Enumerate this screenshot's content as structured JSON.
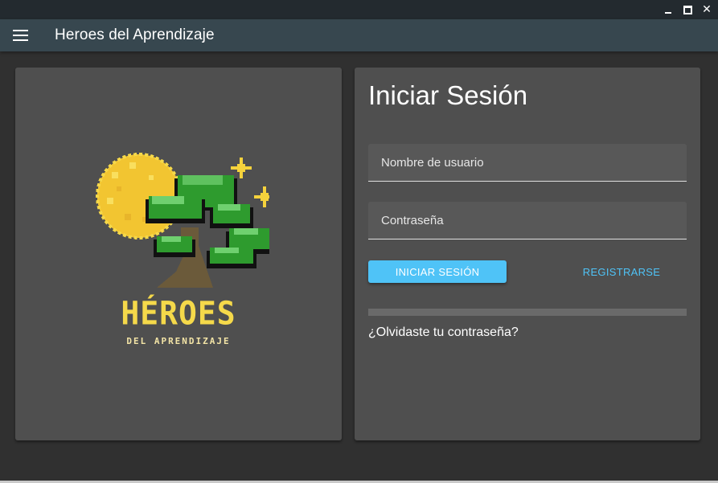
{
  "window": {
    "minimize_icon": "minimize-icon",
    "maximize_icon": "maximize-icon",
    "close_symbol": "✕"
  },
  "appbar": {
    "menu_icon": "hamburger-menu-icon",
    "title": "Heroes del Aprendizaje"
  },
  "logo": {
    "title": "HÉROES",
    "subtitle": "DEL APRENDIZAJE",
    "colors": {
      "moon": "#f5d23c",
      "leaves": "#2e9b2e",
      "trunk": "#6b5a3a",
      "text": "#f5d94a"
    }
  },
  "login": {
    "title": "Iniciar Sesión",
    "username_placeholder": "Nombre de usuario",
    "username_value": "",
    "password_placeholder": "Contraseña",
    "password_value": "",
    "login_button": "INICIAR SESIÓN",
    "register_button": "REGISTRARSE",
    "progress": 0,
    "forgot_link": "¿Olvidaste tu contraseña?"
  },
  "colors": {
    "background": "#303030",
    "appbar": "#37474f",
    "card": "#4f4f4f",
    "accent": "#4fc3f7"
  }
}
